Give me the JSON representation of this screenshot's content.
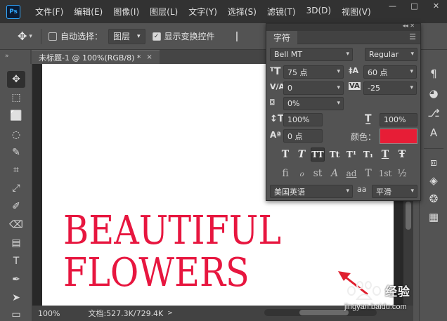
{
  "app": {
    "logo_text": "Ps"
  },
  "menu": [
    "文件(F)",
    "编辑(E)",
    "图像(I)",
    "图层(L)",
    "文字(Y)",
    "选择(S)",
    "滤镜(T)",
    "3D(D)",
    "视图(V)"
  ],
  "window_controls": {
    "minimize": "—",
    "maximize": "□",
    "close": "✕"
  },
  "options_bar": {
    "auto_select_label": "自动选择：",
    "auto_select_checked": false,
    "layer_select_value": "图层",
    "show_transform_label": "显示变换控件",
    "show_transform_checked": true
  },
  "document_tab": {
    "title": "未标题-1 @ 100%(RGB/8) *",
    "close": "×"
  },
  "canvas": {
    "line1": "BEAUTIFUL",
    "line2": "FLOWERS",
    "text_color": "#e7163f"
  },
  "status_bar": {
    "zoom": "100%",
    "doc_size": "文档:527.3K/729.4K",
    "arrow": ">"
  },
  "character_panel": {
    "tab_label": "字符",
    "font_family": "Bell MT",
    "font_style": "Regular",
    "font_size": "75 点",
    "leading": "60 点",
    "kerning": "0",
    "tracking": "-25",
    "tsume": "0%",
    "vertical_scale": "100%",
    "horizontal_scale": "100%",
    "baseline_shift": "0 点",
    "color_label": "颜色：",
    "color_value": "#e71d36",
    "language": "美国英语",
    "antialias_label": "aa",
    "antialias": "平滑",
    "style_buttons": [
      "T",
      "T",
      "TT",
      "Tt",
      "T¹",
      "T₁",
      "T",
      "Ŧ"
    ],
    "opentype_buttons": [
      "fi",
      "ℴ",
      "st",
      "A",
      "ad",
      "T",
      "1st",
      "½"
    ]
  },
  "watermark": {
    "name": "经验",
    "url": "jingyan.baidu.com"
  },
  "colors": {
    "accent_red": "#e7163f",
    "panel_bg": "#535353",
    "menubar_bg": "#323232"
  }
}
